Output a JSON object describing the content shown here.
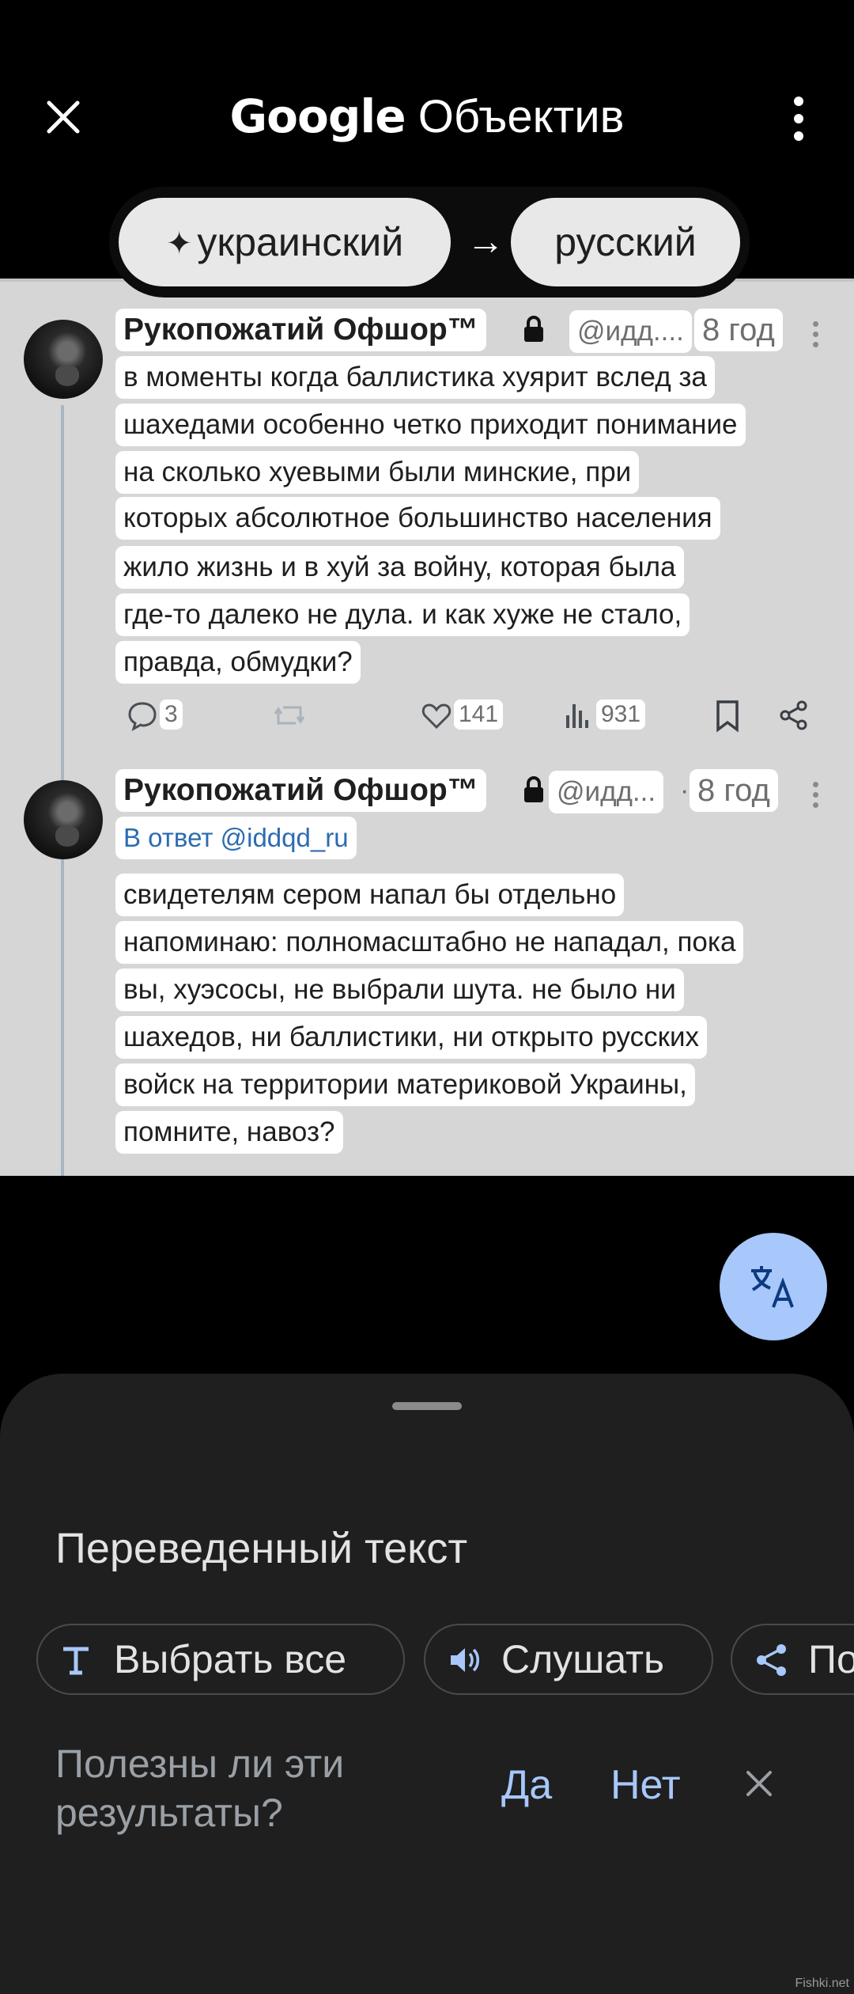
{
  "header": {
    "close_icon": "close-icon",
    "brand": "Google",
    "product": "Объектив",
    "menu_icon": "more-vert-icon"
  },
  "language": {
    "source": "украинский",
    "source_icon": "sparkle-icon",
    "arrow": "→",
    "target": "русский"
  },
  "posts": [
    {
      "name": "Рукопожатий Офшор™",
      "handle": "@идд....",
      "ago": "8 год",
      "lines": [
        "в моменты когда баллистика хуярит вслед за",
        "шахедами особенно четко приходит понимание",
        "на сколько хуевыми были минские, при",
        "которых абсолютное большинство населения",
        "жило жизнь и в хуй за войну, которая была",
        "где-то далеко не дула. и как хуже не стало,",
        "правда, обмудки?"
      ],
      "actions": {
        "replies": "3",
        "likes": "141",
        "views": "931"
      }
    },
    {
      "name": "Рукопожатий Офшор™",
      "handle": "@идд...",
      "separator": "·",
      "ago": "8 год",
      "reply_to": "В ответ @iddqd_ru",
      "lines": [
        "свидетелям сером напал бы отдельно",
        "напоминаю: полномасштабно не нападал, пока",
        "вы, хуэсосы, не выбрали шута. не было ни",
        "шахедов, ни баллистики, ни открыто русских",
        "войск на территории материковой Украины,",
        "помните, навоз?"
      ]
    }
  ],
  "sheet": {
    "title": "Переведенный текст",
    "chips": [
      {
        "label": "Выбрать все",
        "icon": "text-select-icon"
      },
      {
        "label": "Слушать",
        "icon": "speaker-icon"
      },
      {
        "label": "По",
        "icon": "share-icon"
      }
    ],
    "feedback_question": "Полезны ли эти результаты?",
    "yes": "Да",
    "no": "Нет"
  },
  "colors": {
    "accent": "#a8c7fa",
    "sheet_bg": "#1f1f1f",
    "screenshot_bg": "#d6d6d6"
  },
  "watermark": "Fishki.net"
}
